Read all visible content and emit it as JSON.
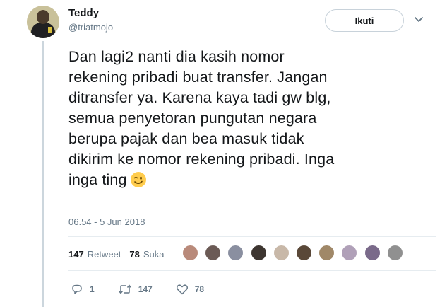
{
  "author": {
    "name": "Teddy",
    "handle": "@triatmojo"
  },
  "header": {
    "follow_label": "Ikuti"
  },
  "tweet": {
    "lines": [
      "Dan lagi2 nanti dia kasih nomor",
      "rekening pribadi buat transfer. Jangan",
      "ditransfer ya. Karena kaya tadi gw blg,",
      "semua penyetoran pungutan negara",
      "berupa pajak dan bea masuk tidak",
      "dikirim ke nomor rekening pribadi. Inga",
      "inga ting"
    ],
    "emoji": "winking-face-icon",
    "timestamp": "06.54 - 5 Jun 2018"
  },
  "stats": {
    "retweets_count": "147",
    "retweets_label": "Retweet",
    "likes_count": "78",
    "likes_label": "Suka"
  },
  "liker_avatars": [
    {
      "icon": "user-avatar-icon",
      "color": "#b98a7a"
    },
    {
      "icon": "user-avatar-icon",
      "color": "#6b5a55"
    },
    {
      "icon": "user-avatar-icon",
      "color": "#8a8fa0"
    },
    {
      "icon": "user-avatar-icon",
      "color": "#3d3530"
    },
    {
      "icon": "user-avatar-icon",
      "color": "#c8b8a8"
    },
    {
      "icon": "user-avatar-icon",
      "color": "#5a4838"
    },
    {
      "icon": "user-avatar-icon",
      "color": "#a08868"
    },
    {
      "icon": "user-avatar-icon",
      "color": "#b0a0b8"
    },
    {
      "icon": "user-avatar-icon",
      "color": "#7a6a8a"
    },
    {
      "icon": "user-avatar-icon",
      "color": "#909090"
    }
  ],
  "actions": {
    "reply_count": "1",
    "retweet_count": "147",
    "like_count": "78"
  },
  "colors": {
    "text": "#14171a",
    "muted": "#657786",
    "divider": "#e6ecf0"
  }
}
